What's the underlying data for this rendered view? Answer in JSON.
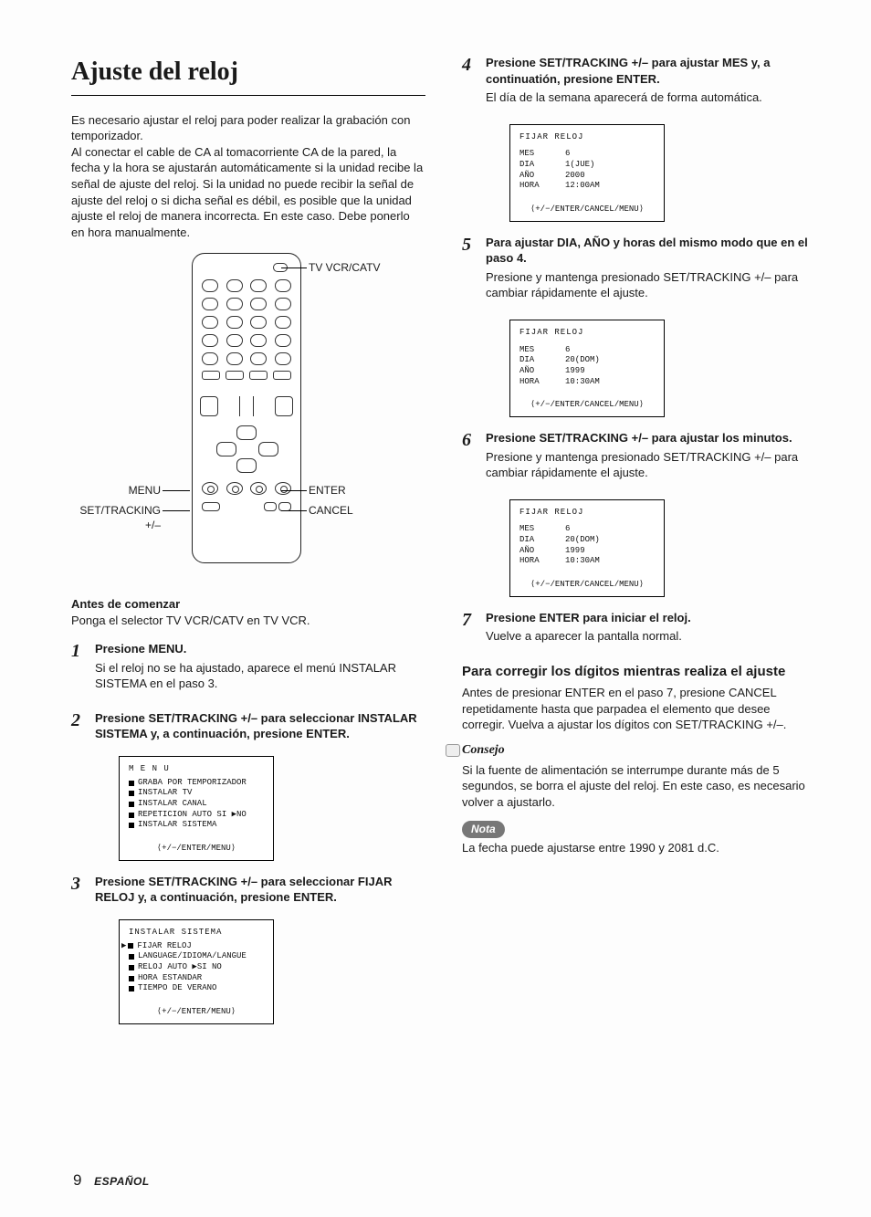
{
  "title": "Ajuste del reloj",
  "intro": "Es necesario ajustar el reloj para poder realizar la grabación con temporizador.\nAl conectar el cable de CA al tomacorriente CA de la pared, la fecha y la hora se ajustarán automáticamente si la unidad recibe la señal de ajuste del reloj. Si la unidad no puede recibir la señal de ajuste del reloj o si dicha señal es débil, es posible que la unidad ajuste el reloj de manera incorrecta. En este caso. Debe ponerlo en hora manualmente.",
  "callouts": {
    "tv": "TV VCR/CATV",
    "menu": "MENU",
    "set": "SET/TRACKING +/–",
    "enter": "ENTER",
    "cancel": "CANCEL"
  },
  "before": {
    "head": "Antes de comenzar",
    "text": "Ponga el selector TV VCR/CATV en TV VCR."
  },
  "steps": {
    "s1": {
      "n": "1",
      "head": "Presione MENU.",
      "text": "Si el reloj no se ha ajustado, aparece el menú INSTALAR SISTEMA en el paso 3."
    },
    "s2": {
      "n": "2",
      "head": "Presione SET/TRACKING +/– para seleccionar INSTALAR SISTEMA y, a continuación, presione ENTER."
    },
    "s3": {
      "n": "3",
      "head": "Presione SET/TRACKING +/– para seleccionar FIJAR RELOJ y, a continuación, presione ENTER."
    },
    "s4": {
      "n": "4",
      "head": "Presione SET/TRACKING +/– para ajustar MES y, a continuatión, presione ENTER.",
      "text": "El día de la semana aparecerá de forma automática."
    },
    "s5": {
      "n": "5",
      "head": "Para ajustar DIA, AÑO y horas del mismo modo que en el paso 4.",
      "text": "Presione y mantenga presionado SET/TRACKING +/– para cambiar rápidamente el ajuste."
    },
    "s6": {
      "n": "6",
      "head": "Presione SET/TRACKING +/– para ajustar los minutos.",
      "text": "Presione y mantenga presionado SET/TRACKING +/– para cambiar rápidamente el ajuste."
    },
    "s7": {
      "n": "7",
      "head": "Presione ENTER para iniciar el reloj.",
      "text": "Vuelve a aparecer la pantalla normal."
    }
  },
  "screens": {
    "scr2": {
      "title": "M E N U",
      "lines": [
        "GRABA POR TEMPORIZADOR",
        "INSTALAR TV",
        "INSTALAR CANAL",
        "REPETICION AUTO   SI ▶NO",
        "INSTALAR SISTEMA"
      ],
      "footer": "⟨+/−/ENTER/MENU⟩"
    },
    "scr3": {
      "title": "INSTALAR SISTEMA",
      "lines": [
        "FIJAR RELOJ",
        "LANGUAGE/IDIOMA/LANGUE",
        "RELOJ AUTO  ▶SI   NO",
        "HORA ESTANDAR",
        "TIEMPO DE VERANO"
      ],
      "pointer": 0,
      "footer": "⟨+/−/ENTER/MENU⟩"
    },
    "scr4": {
      "title": "FIJAR RELOJ",
      "rows": [
        [
          "MES",
          "6"
        ],
        [
          "DIA",
          "1(JUE)"
        ],
        [
          "AÑO",
          "2000"
        ],
        [
          "HORA",
          "12:00AM"
        ]
      ],
      "hl": 0,
      "footer": "⟨+/−/ENTER/CANCEL/MENU⟩"
    },
    "scr5": {
      "title": "FIJAR RELOJ",
      "rows": [
        [
          "MES",
          "6"
        ],
        [
          "DIA",
          "20(DOM)"
        ],
        [
          "AÑO",
          "1999"
        ],
        [
          "HORA",
          "10:30AM"
        ]
      ],
      "hl": 3,
      "footer": "⟨+/−/ENTER/CANCEL/MENU⟩"
    },
    "scr6": {
      "title": "FIJAR RELOJ",
      "rows": [
        [
          "MES",
          "6"
        ],
        [
          "DIA",
          "20(DOM)"
        ],
        [
          "AÑO",
          "1999"
        ],
        [
          "HORA",
          "10:30AM"
        ]
      ],
      "hl": 3,
      "footer": "⟨+/−/ENTER/CANCEL/MENU⟩"
    }
  },
  "correct": {
    "head": "Para corregir los dígitos mientras realiza el ajuste",
    "text": "Antes de presionar ENTER en el paso 7, presione CANCEL repetidamente hasta que parpadea el elemento que desee corregir. Vuelva a ajustar los dígitos con SET/TRACKING +/–."
  },
  "tip": {
    "label": "Consejo",
    "text": "Si la fuente de alimentación se interrumpe durante más de 5 segundos, se borra el ajuste del reloj. En este caso, es necesario volver a ajustarlo."
  },
  "note": {
    "label": "Nota",
    "text": "La fecha puede ajustarse entre 1990 y 2081 d.C."
  },
  "footer": {
    "page": "9",
    "lang": "ESPAÑOL"
  }
}
